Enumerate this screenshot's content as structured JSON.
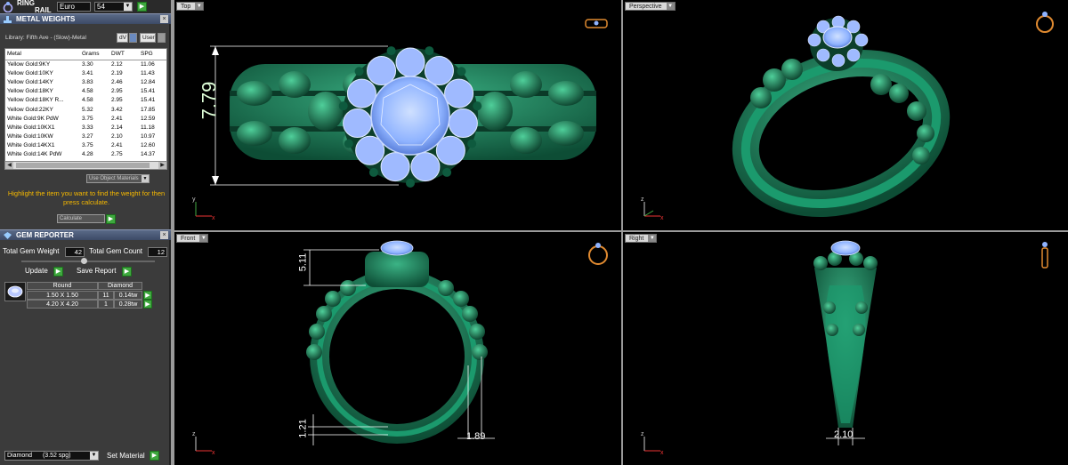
{
  "ring_rail": {
    "brand_line1": "RING",
    "brand_line2": "RAIL",
    "size_system": "Euro",
    "size_value": "54"
  },
  "metal_weights": {
    "title": "METAL WEIGHTS",
    "library": "Library: Fifth Ave - (Slow)-Metal",
    "btn_dv": "dV",
    "btn_user": "User",
    "columns": [
      "Metal",
      "Grams",
      "DWT",
      "SPG"
    ],
    "rows": [
      [
        "Yellow Gold:9KY",
        "3.30",
        "2.12",
        "11.06"
      ],
      [
        "Yellow Gold:10KY",
        "3.41",
        "2.19",
        "11.43"
      ],
      [
        "Yellow Gold:14KY",
        "3.83",
        "2.46",
        "12.84"
      ],
      [
        "Yellow Gold:18KY",
        "4.58",
        "2.95",
        "15.41"
      ],
      [
        "Yellow Gold:18KY R...",
        "4.58",
        "2.95",
        "15.41"
      ],
      [
        "Yellow Gold:22KY",
        "5.32",
        "3.42",
        "17.85"
      ],
      [
        "White Gold:9K PdW",
        "3.75",
        "2.41",
        "12.59"
      ],
      [
        "White Gold:10KX1",
        "3.33",
        "2.14",
        "11.18"
      ],
      [
        "White Gold:10KW",
        "3.27",
        "2.10",
        "10.97"
      ],
      [
        "White Gold:14KX1",
        "3.75",
        "2.41",
        "12.60"
      ],
      [
        "White Gold:14K PdW",
        "4.28",
        "2.75",
        "14.37"
      ]
    ],
    "use_object_materials": "Use Object Materials",
    "hint": "Highlight the item you want to find the weight for then press calculate.",
    "calculate": "Calculate"
  },
  "gem_reporter": {
    "title": "GEM REPORTER",
    "total_gem_weight_label": "Total Gem Weight",
    "total_gem_weight": "42",
    "total_gem_count_label": "Total Gem Count",
    "total_gem_count": "12",
    "update": "Update",
    "save_report": "Save Report",
    "col_shape": "Round",
    "col_type": "Diamond",
    "rows": [
      {
        "size": "1.50 X 1.50",
        "count": "11",
        "tw": "0.14tw"
      },
      {
        "size": "4.20 X 4.20",
        "count": "1",
        "tw": "0.28tw"
      }
    ],
    "material_select": "Diamond",
    "material_spg": "(3.52 spg)",
    "set_material": "Set Material"
  },
  "viewports": {
    "top": {
      "label": "Top",
      "dim": "7.79"
    },
    "perspective": {
      "label": "Perspective"
    },
    "front": {
      "label": "Front",
      "dim_top": "5.11",
      "dim_bottom": "1.21",
      "dim_side": "1.89"
    },
    "right": {
      "label": "Right",
      "dim": "2.10"
    }
  },
  "axes": {
    "z": "z",
    "y": "y",
    "x": "x"
  },
  "colors": {
    "metal": "#1a7a56",
    "gem": "#8fb3ff",
    "accent": "#f5b800"
  }
}
